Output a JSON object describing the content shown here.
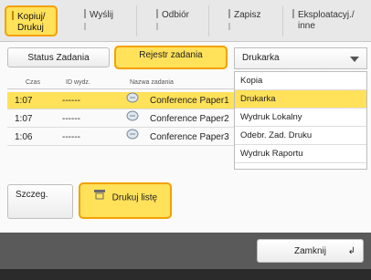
{
  "tabs": [
    {
      "line1": "Kopiuj/",
      "line2": "Drukuj",
      "active": true
    },
    {
      "line1": "Wyślij",
      "line2": "",
      "active": false
    },
    {
      "line1": "Odbiór",
      "line2": "",
      "active": false
    },
    {
      "line1": "Zapisz",
      "line2": "",
      "active": false
    },
    {
      "line1": "Eksploatacyj./",
      "line2": "inne",
      "active": false
    }
  ],
  "buttons": {
    "status": "Status Zadania",
    "rejestr": "Rejestr zadania",
    "szczeg": "Szczeg.",
    "drukuj_liste": "Drukuj listę",
    "zamknij": "Zamknij"
  },
  "dropdown": {
    "selected": "Drukarka",
    "options": [
      "Kopia",
      "Drukarka",
      "Wydruk Lokalny",
      "Odebr. Zad. Druku",
      "Wydruk Raportu"
    ],
    "selected_index": 1
  },
  "table": {
    "headers": {
      "czas": "Czas",
      "id": "ID wydz.",
      "name": "Nazwa zadania"
    },
    "rows": [
      {
        "czas": "1:07",
        "id": "------",
        "name": "Conference Paper1"
      },
      {
        "czas": "1:07",
        "id": "------",
        "name": "Conference Paper2"
      },
      {
        "czas": "1:06",
        "id": "------",
        "name": "Conference Paper3"
      }
    ]
  },
  "colors": {
    "accent": "#ffe15a",
    "accent_border": "#f3a100",
    "footer": "#5a5a5a"
  }
}
